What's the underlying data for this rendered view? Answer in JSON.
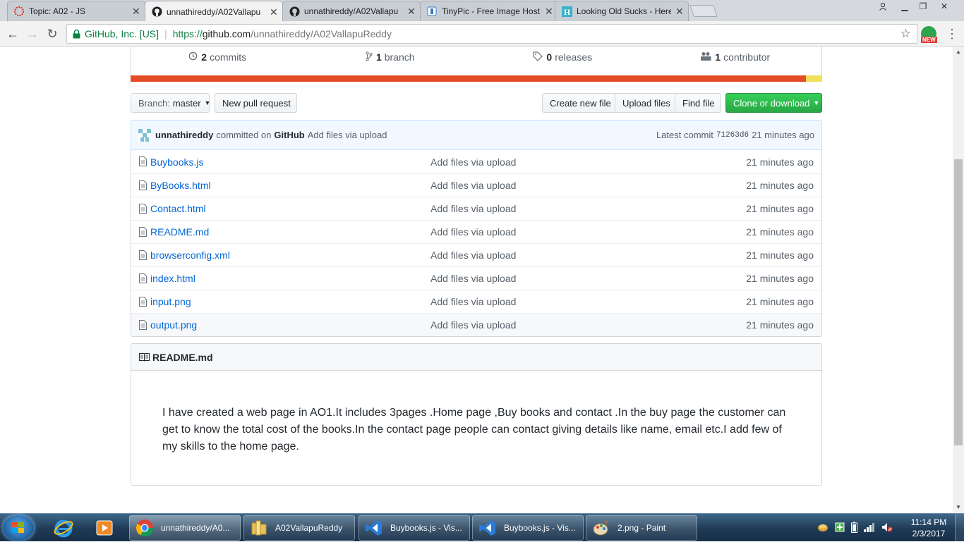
{
  "browser": {
    "tabs": [
      {
        "title": "Topic: A02 - JS",
        "icon": "error-icon"
      },
      {
        "title": "unnathireddy/A02Vallapu",
        "icon": "github-icon"
      },
      {
        "title": "unnathireddy/A02Vallapu",
        "icon": "github-icon"
      },
      {
        "title": "TinyPic - Free Image Host",
        "icon": "tinypic-icon"
      },
      {
        "title": "Looking Old Sucks - Here",
        "icon": "h-icon"
      }
    ],
    "active_tab": 1,
    "address": {
      "secure_label": "GitHub, Inc. [US]",
      "proto": "https://",
      "host": "github.com",
      "path": "/unnathireddy/A02VallapuReddy"
    },
    "extension_badge": "NEW"
  },
  "repo": {
    "summary": {
      "commits_count": "2",
      "commits_label": "commits",
      "branch_count": "1",
      "branch_label": "branch",
      "releases_count": "0",
      "releases_label": "releases",
      "contributor_count": "1",
      "contributor_label": "contributor"
    },
    "language_colors": [
      "#e34c26",
      "#f1e05a"
    ],
    "language_fractions": [
      0.977,
      0.023
    ],
    "branch_prefix": "Branch:",
    "branch_name": "master",
    "new_pull_request": "New pull request",
    "create_new_file": "Create new file",
    "upload_files": "Upload files",
    "find_file": "Find file",
    "clone_or_download": "Clone or download",
    "latest_commit": {
      "author": "unnathireddy",
      "committed_on": "committed on",
      "committer": "GitHub",
      "message": "Add files via upload",
      "prefix": "Latest commit",
      "sha": "71263d6",
      "age": "21 minutes ago"
    },
    "files": [
      {
        "name": "Buybooks.js",
        "message": "Add files via upload",
        "age": "21 minutes ago"
      },
      {
        "name": "ByBooks.html",
        "message": "Add files via upload",
        "age": "21 minutes ago"
      },
      {
        "name": "Contact.html",
        "message": "Add files via upload",
        "age": "21 minutes ago"
      },
      {
        "name": "README.md",
        "message": "Add files via upload",
        "age": "21 minutes ago"
      },
      {
        "name": "browserconfig.xml",
        "message": "Add files via upload",
        "age": "21 minutes ago"
      },
      {
        "name": "index.html",
        "message": "Add files via upload",
        "age": "21 minutes ago"
      },
      {
        "name": "input.png",
        "message": "Add files via upload",
        "age": "21 minutes ago"
      },
      {
        "name": "output.png",
        "message": "Add files via upload",
        "age": "21 minutes ago"
      }
    ],
    "readme": {
      "title": "README.md",
      "text": "I have created a web page in AO1.It includes 3pages .Home page ,Buy books and contact .In the buy page the customer can get to know the total cost of the books.In the contact page people can contact giving details like name, email etc.I add few of my skills to the home page."
    }
  },
  "taskbar": {
    "pinned": [
      "internet-explorer-icon",
      "media-player-icon"
    ],
    "tasks": [
      {
        "label": "unnathireddy/A0...",
        "icon": "chrome-icon"
      },
      {
        "label": "A02VallapuReddy",
        "icon": "folder-icon"
      },
      {
        "label": "Buybooks.js - Vis...",
        "icon": "vscode-icon"
      },
      {
        "label": "Buybooks.js - Vis...",
        "icon": "vscode-icon"
      },
      {
        "label": "2.png - Paint",
        "icon": "paint-icon"
      }
    ],
    "clock_time": "11:14 PM",
    "clock_date": "2/3/2017"
  }
}
